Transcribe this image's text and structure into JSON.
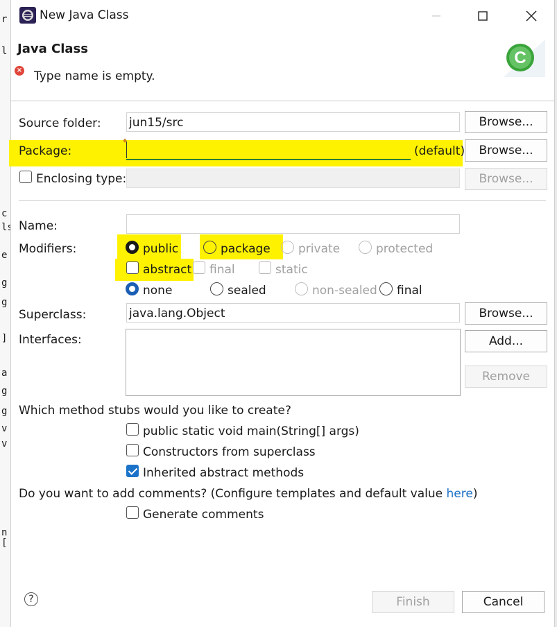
{
  "window": {
    "title": "New Java Class",
    "minimize_glyph": "–",
    "maximize_glyph": "☐",
    "close_glyph": "✕"
  },
  "header": {
    "title": "Java Class",
    "error_message": "Type name is empty.",
    "banner_letter": "C"
  },
  "source_folder": {
    "label": "Source folder:",
    "value": "jun15/src",
    "browse_label": "Browse..."
  },
  "package": {
    "label": "Package:",
    "value": "",
    "suffix": "(default)",
    "browse_label": "Browse..."
  },
  "enclosing_type": {
    "label": "Enclosing type:",
    "value": "",
    "checked": false,
    "browse_label": "Browse..."
  },
  "name": {
    "label": "Name:",
    "value": ""
  },
  "modifiers": {
    "label": "Modifiers:",
    "access": {
      "public": "public",
      "package": "package",
      "private": "private",
      "protected": "protected",
      "selected": "public"
    },
    "other": {
      "abstract": "abstract",
      "final": "final",
      "static": "static"
    },
    "inheritance": {
      "none": "none",
      "sealed": "sealed",
      "non_sealed": "non-sealed",
      "final": "final",
      "selected": "none"
    }
  },
  "superclass": {
    "label": "Superclass:",
    "value": "java.lang.Object",
    "browse_label": "Browse..."
  },
  "interfaces": {
    "label": "Interfaces:",
    "add_label": "Add...",
    "remove_label": "Remove"
  },
  "stubs": {
    "question": "Which method stubs would you like to create?",
    "main": {
      "label": "public static void main(String[] args)",
      "checked": false
    },
    "constructors": {
      "label": "Constructors from superclass",
      "checked": false
    },
    "inherited": {
      "label": "Inherited abstract methods",
      "checked": true
    }
  },
  "comments": {
    "question_prefix": "Do you want to add comments? (Configure templates and default value ",
    "link": "here",
    "question_suffix": ")",
    "generate": {
      "label": "Generate comments",
      "checked": false
    }
  },
  "footer": {
    "help_glyph": "?",
    "finish_label": "Finish",
    "cancel_label": "Cancel"
  },
  "colors": {
    "highlight": "#fff200",
    "accent": "#1a5fb4",
    "link": "#1a6fc4",
    "error": "#e0453a"
  },
  "background_glyphs": [
    "r",
    "l",
    "c",
    "ls",
    "e",
    "g",
    "g",
    "]",
    "a",
    "g",
    "g",
    "v",
    "v",
    "n",
    "["
  ]
}
